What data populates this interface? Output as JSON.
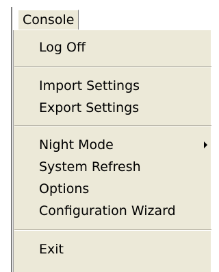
{
  "menu": {
    "title": "Console",
    "items": {
      "log_off": "Log Off",
      "import_settings": "Import Settings",
      "export_settings": "Export Settings",
      "night_mode": "Night Mode",
      "system_refresh": "System Refresh",
      "options": "Options",
      "configuration_wizard": "Configuration Wizard",
      "exit": "Exit"
    },
    "icons": {
      "submenu": "chevron-right-icon"
    }
  }
}
